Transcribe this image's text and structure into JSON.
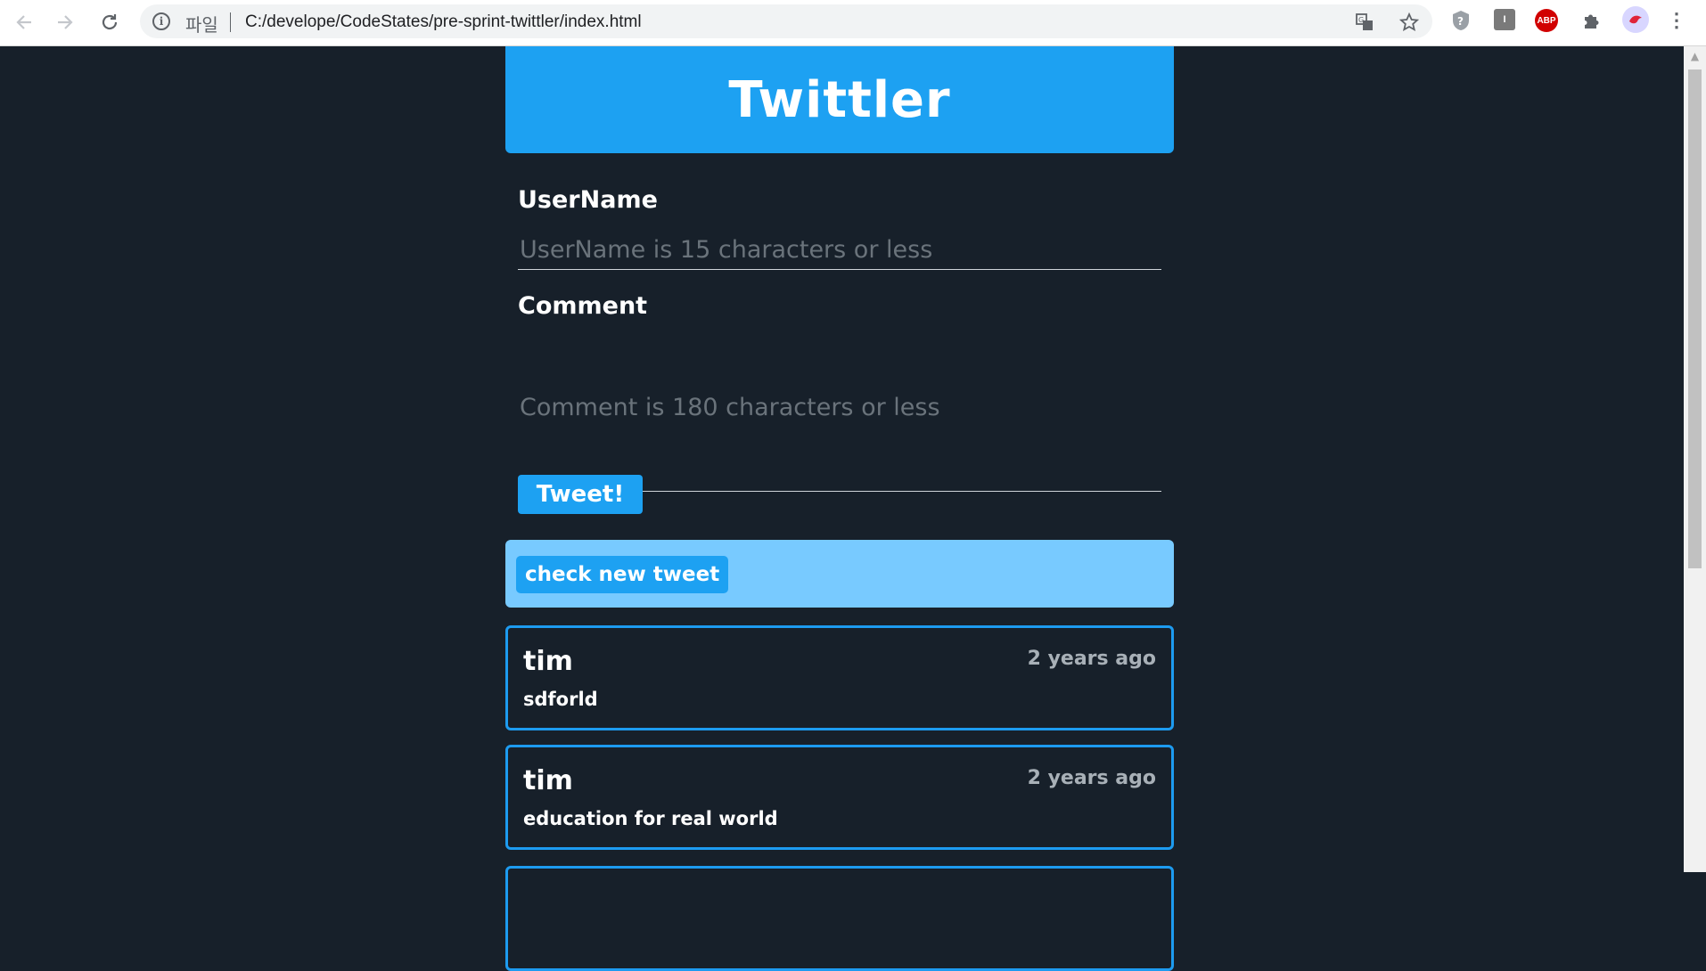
{
  "browser": {
    "back_icon": "arrow-left-icon",
    "forward_icon": "arrow-right-icon",
    "reload_icon": "reload-icon",
    "scheme_label": "파일",
    "url": "C:/develope/CodeStates/pre-sprint-twittler/index.html",
    "extensions": [
      "translate-icon",
      "star-icon",
      "shield-icon",
      "ext-i-icon",
      "adblock-icon",
      "puzzle-icon",
      "profile-avatar",
      "menu-dots-icon"
    ],
    "adblock_label": "ABP",
    "ext_i_label": "I"
  },
  "header": {
    "title": "Twittler",
    "color": "#1da1f2"
  },
  "form": {
    "username_label": "UserName",
    "username_placeholder": "UserName is 15 characters or less",
    "username_value": "",
    "comment_label": "Comment",
    "comment_placeholder": "Comment is 180 characters or less",
    "comment_value": "",
    "submit_label": "Tweet!"
  },
  "check_new": {
    "label": "check new tweet"
  },
  "tweets": [
    {
      "user": "tim",
      "time": "2 years ago",
      "message": "sdforld"
    },
    {
      "user": "tim",
      "time": "2 years ago",
      "message": "education for real world"
    }
  ]
}
